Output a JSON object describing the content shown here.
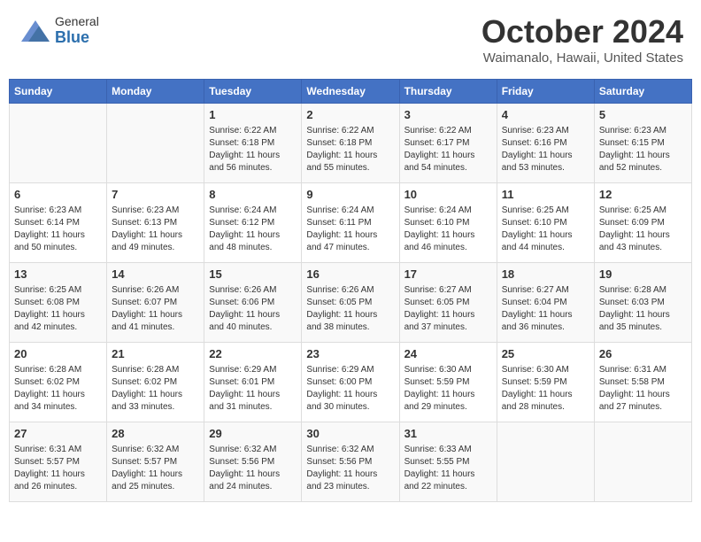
{
  "header": {
    "logo_general": "General",
    "logo_blue": "Blue",
    "month_title": "October 2024",
    "location": "Waimanalo, Hawaii, United States"
  },
  "days_of_week": [
    "Sunday",
    "Monday",
    "Tuesday",
    "Wednesday",
    "Thursday",
    "Friday",
    "Saturday"
  ],
  "weeks": [
    [
      {
        "day": "",
        "sunrise": "",
        "sunset": "",
        "daylight": ""
      },
      {
        "day": "",
        "sunrise": "",
        "sunset": "",
        "daylight": ""
      },
      {
        "day": "1",
        "sunrise": "Sunrise: 6:22 AM",
        "sunset": "Sunset: 6:18 PM",
        "daylight": "Daylight: 11 hours and 56 minutes."
      },
      {
        "day": "2",
        "sunrise": "Sunrise: 6:22 AM",
        "sunset": "Sunset: 6:18 PM",
        "daylight": "Daylight: 11 hours and 55 minutes."
      },
      {
        "day": "3",
        "sunrise": "Sunrise: 6:22 AM",
        "sunset": "Sunset: 6:17 PM",
        "daylight": "Daylight: 11 hours and 54 minutes."
      },
      {
        "day": "4",
        "sunrise": "Sunrise: 6:23 AM",
        "sunset": "Sunset: 6:16 PM",
        "daylight": "Daylight: 11 hours and 53 minutes."
      },
      {
        "day": "5",
        "sunrise": "Sunrise: 6:23 AM",
        "sunset": "Sunset: 6:15 PM",
        "daylight": "Daylight: 11 hours and 52 minutes."
      }
    ],
    [
      {
        "day": "6",
        "sunrise": "Sunrise: 6:23 AM",
        "sunset": "Sunset: 6:14 PM",
        "daylight": "Daylight: 11 hours and 50 minutes."
      },
      {
        "day": "7",
        "sunrise": "Sunrise: 6:23 AM",
        "sunset": "Sunset: 6:13 PM",
        "daylight": "Daylight: 11 hours and 49 minutes."
      },
      {
        "day": "8",
        "sunrise": "Sunrise: 6:24 AM",
        "sunset": "Sunset: 6:12 PM",
        "daylight": "Daylight: 11 hours and 48 minutes."
      },
      {
        "day": "9",
        "sunrise": "Sunrise: 6:24 AM",
        "sunset": "Sunset: 6:11 PM",
        "daylight": "Daylight: 11 hours and 47 minutes."
      },
      {
        "day": "10",
        "sunrise": "Sunrise: 6:24 AM",
        "sunset": "Sunset: 6:10 PM",
        "daylight": "Daylight: 11 hours and 46 minutes."
      },
      {
        "day": "11",
        "sunrise": "Sunrise: 6:25 AM",
        "sunset": "Sunset: 6:10 PM",
        "daylight": "Daylight: 11 hours and 44 minutes."
      },
      {
        "day": "12",
        "sunrise": "Sunrise: 6:25 AM",
        "sunset": "Sunset: 6:09 PM",
        "daylight": "Daylight: 11 hours and 43 minutes."
      }
    ],
    [
      {
        "day": "13",
        "sunrise": "Sunrise: 6:25 AM",
        "sunset": "Sunset: 6:08 PM",
        "daylight": "Daylight: 11 hours and 42 minutes."
      },
      {
        "day": "14",
        "sunrise": "Sunrise: 6:26 AM",
        "sunset": "Sunset: 6:07 PM",
        "daylight": "Daylight: 11 hours and 41 minutes."
      },
      {
        "day": "15",
        "sunrise": "Sunrise: 6:26 AM",
        "sunset": "Sunset: 6:06 PM",
        "daylight": "Daylight: 11 hours and 40 minutes."
      },
      {
        "day": "16",
        "sunrise": "Sunrise: 6:26 AM",
        "sunset": "Sunset: 6:05 PM",
        "daylight": "Daylight: 11 hours and 38 minutes."
      },
      {
        "day": "17",
        "sunrise": "Sunrise: 6:27 AM",
        "sunset": "Sunset: 6:05 PM",
        "daylight": "Daylight: 11 hours and 37 minutes."
      },
      {
        "day": "18",
        "sunrise": "Sunrise: 6:27 AM",
        "sunset": "Sunset: 6:04 PM",
        "daylight": "Daylight: 11 hours and 36 minutes."
      },
      {
        "day": "19",
        "sunrise": "Sunrise: 6:28 AM",
        "sunset": "Sunset: 6:03 PM",
        "daylight": "Daylight: 11 hours and 35 minutes."
      }
    ],
    [
      {
        "day": "20",
        "sunrise": "Sunrise: 6:28 AM",
        "sunset": "Sunset: 6:02 PM",
        "daylight": "Daylight: 11 hours and 34 minutes."
      },
      {
        "day": "21",
        "sunrise": "Sunrise: 6:28 AM",
        "sunset": "Sunset: 6:02 PM",
        "daylight": "Daylight: 11 hours and 33 minutes."
      },
      {
        "day": "22",
        "sunrise": "Sunrise: 6:29 AM",
        "sunset": "Sunset: 6:01 PM",
        "daylight": "Daylight: 11 hours and 31 minutes."
      },
      {
        "day": "23",
        "sunrise": "Sunrise: 6:29 AM",
        "sunset": "Sunset: 6:00 PM",
        "daylight": "Daylight: 11 hours and 30 minutes."
      },
      {
        "day": "24",
        "sunrise": "Sunrise: 6:30 AM",
        "sunset": "Sunset: 5:59 PM",
        "daylight": "Daylight: 11 hours and 29 minutes."
      },
      {
        "day": "25",
        "sunrise": "Sunrise: 6:30 AM",
        "sunset": "Sunset: 5:59 PM",
        "daylight": "Daylight: 11 hours and 28 minutes."
      },
      {
        "day": "26",
        "sunrise": "Sunrise: 6:31 AM",
        "sunset": "Sunset: 5:58 PM",
        "daylight": "Daylight: 11 hours and 27 minutes."
      }
    ],
    [
      {
        "day": "27",
        "sunrise": "Sunrise: 6:31 AM",
        "sunset": "Sunset: 5:57 PM",
        "daylight": "Daylight: 11 hours and 26 minutes."
      },
      {
        "day": "28",
        "sunrise": "Sunrise: 6:32 AM",
        "sunset": "Sunset: 5:57 PM",
        "daylight": "Daylight: 11 hours and 25 minutes."
      },
      {
        "day": "29",
        "sunrise": "Sunrise: 6:32 AM",
        "sunset": "Sunset: 5:56 PM",
        "daylight": "Daylight: 11 hours and 24 minutes."
      },
      {
        "day": "30",
        "sunrise": "Sunrise: 6:32 AM",
        "sunset": "Sunset: 5:56 PM",
        "daylight": "Daylight: 11 hours and 23 minutes."
      },
      {
        "day": "31",
        "sunrise": "Sunrise: 6:33 AM",
        "sunset": "Sunset: 5:55 PM",
        "daylight": "Daylight: 11 hours and 22 minutes."
      },
      {
        "day": "",
        "sunrise": "",
        "sunset": "",
        "daylight": ""
      },
      {
        "day": "",
        "sunrise": "",
        "sunset": "",
        "daylight": ""
      }
    ]
  ]
}
